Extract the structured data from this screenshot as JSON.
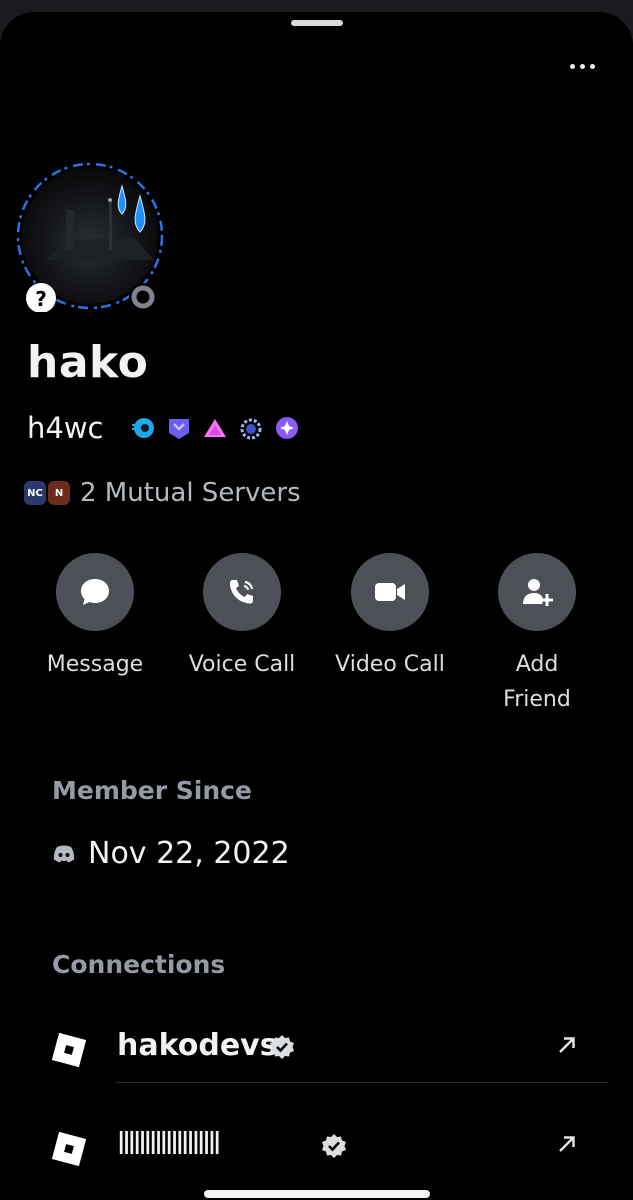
{
  "profile": {
    "display_name": "hako",
    "username": "h4wc",
    "badges": [
      "hypesquad-icon",
      "server-booster-icon",
      "nitro-icon",
      "laurel-icon",
      "quest-icon"
    ]
  },
  "mutual": {
    "text": "2 Mutual Servers",
    "server_icons": [
      "NC",
      "N"
    ]
  },
  "actions": [
    {
      "label": "Message",
      "icon": "chat-bubble-icon"
    },
    {
      "label": "Voice Call",
      "icon": "phone-icon"
    },
    {
      "label": "Video Call",
      "icon": "video-camera-icon"
    },
    {
      "label": "Add\nFriend",
      "icon": "add-friend-icon"
    }
  ],
  "member_since": {
    "title": "Member Since",
    "date": "Nov 22, 2022",
    "icon": "discord-logo-icon"
  },
  "connections": {
    "title": "Connections",
    "items": [
      {
        "platform_icon": "roblox-icon",
        "name": "hakodevs",
        "verified": true
      },
      {
        "platform_icon": "roblox-icon",
        "name": "lllllllllllllllllll",
        "verified": true
      }
    ]
  },
  "colors": {
    "background": "#000000",
    "action_circle": "#4e5058",
    "muted_text": "#949ba4",
    "status_offline": "#80848e"
  }
}
